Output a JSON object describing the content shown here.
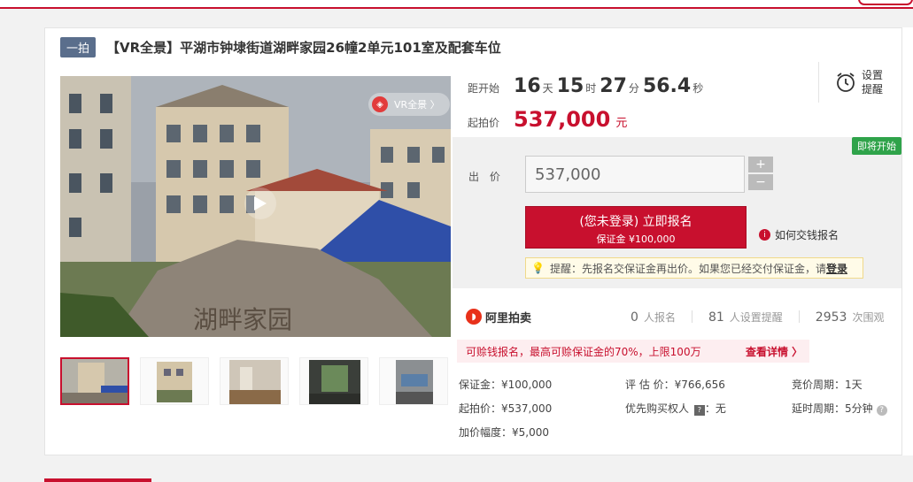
{
  "title": {
    "tag": "一拍",
    "text": "【VR全景】平湖市钟埭街道湖畔家园26幢2单元101室及配套车位"
  },
  "media": {
    "vr_label": "VR全景 〉",
    "vr_icon": "vr-logo-icon",
    "play_icon": "play-icon",
    "thumbnail_count": 5
  },
  "countdown": {
    "label": "距开始",
    "days": "16",
    "days_unit": "天",
    "hours": "15",
    "hours_unit": "时",
    "minutes": "27",
    "minutes_unit": "分",
    "seconds": "56.4",
    "seconds_unit": "秒"
  },
  "start_price": {
    "label": "起拍价",
    "value": "537,000",
    "unit": "元"
  },
  "reminder": {
    "line1": "设置",
    "line2": "提醒",
    "icon": "alarm-clock-icon"
  },
  "bid": {
    "badge": "即将开始",
    "label": "出 价",
    "value": "537,000",
    "plus": "+",
    "minus": "−",
    "register_main": "(您未登录) 立即报名",
    "register_sub": "保证金 ¥100,000",
    "howto": "如何交钱报名",
    "tip_text": "提醒：先报名交保证金再出价。如果您已经交付保证金，请",
    "tip_login": "登录"
  },
  "stats": {
    "brand": "阿里拍卖",
    "signups": "0",
    "signups_label": "人报名",
    "reminders": "81",
    "reminders_label": "人设置提醒",
    "views": "2953",
    "views_label": "次围观"
  },
  "promo": {
    "text": "可赊钱报名，最高可赊保证金的70%，上限100万",
    "more": "查看详情 〉"
  },
  "details": {
    "deposit": "保证金：¥100,000",
    "appraisal": "评 估 价：¥766,656",
    "cycle": "竞价周期：1天",
    "start": "起拍价：¥537,000",
    "priority_prefix": "优先购买权人",
    "priority_value": "：无",
    "delay": "延时周期：5分钟",
    "increment": "加价幅度：¥5,000"
  },
  "colors": {
    "accent": "#c8102e",
    "success": "#2fa34a",
    "tag_bg": "#5a6e8c"
  }
}
